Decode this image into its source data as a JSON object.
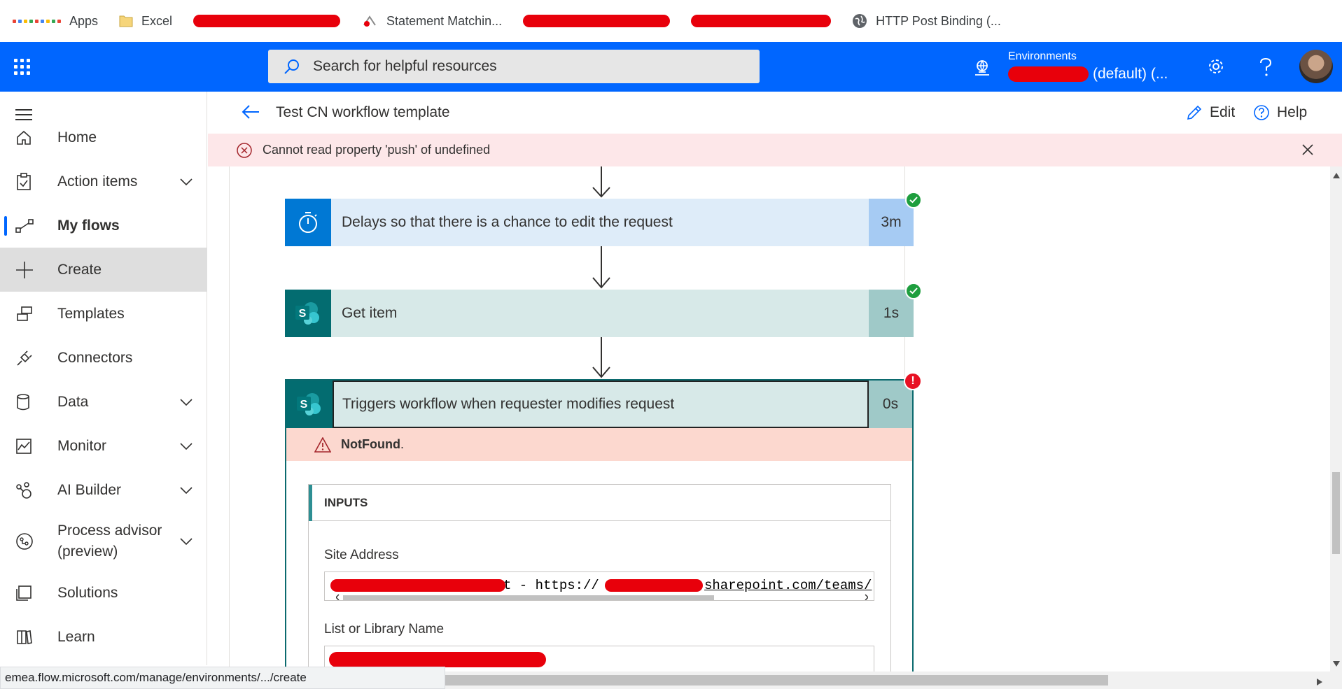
{
  "bookmarks": {
    "apps": "Apps",
    "excel": "Excel",
    "statement": "Statement Matchin...",
    "http": "HTTP Post Binding (..."
  },
  "header": {
    "search_placeholder": "Search for helpful resources",
    "env_label": "Environments",
    "env_name": "(default) (..."
  },
  "sidebar": {
    "items": [
      {
        "label": "Home"
      },
      {
        "label": "Action items"
      },
      {
        "label": "My flows"
      },
      {
        "label": "Create"
      },
      {
        "label": "Templates"
      },
      {
        "label": "Connectors"
      },
      {
        "label": "Data"
      },
      {
        "label": "Monitor"
      },
      {
        "label": "AI Builder"
      },
      {
        "label": "Process advisor",
        "label2": "(preview)"
      },
      {
        "label": "Solutions"
      },
      {
        "label": "Learn"
      }
    ]
  },
  "command_bar": {
    "flow_title": "Test CN workflow template",
    "edit": "Edit",
    "help": "Help"
  },
  "error_bar": {
    "message": "Cannot read property 'push' of undefined"
  },
  "flow": {
    "steps": [
      {
        "title": "Delays so that there is a chance to edit the request",
        "duration": "3m",
        "status": "succeeded",
        "color": "#0078d4"
      },
      {
        "title": "Get item",
        "duration": "1s",
        "status": "succeeded",
        "color": "#036c70"
      },
      {
        "title": "Triggers workflow when requester modifies request",
        "duration": "0s",
        "status": "failed",
        "color": "#036c70"
      }
    ],
    "error_text": "NotFound",
    "error_suffix": ".",
    "inputs_header": "INPUTS",
    "site_address_label": "Site Address",
    "site_address_visible": "t - https://",
    "site_address_suffix": "sharepoint.com/teams/",
    "list_name_label": "List or Library Name"
  },
  "status_url": "emea.flow.microsoft.com/manage/environments/.../create",
  "colors": {
    "brand_blue": "#0066ff",
    "error_red": "#e81123",
    "success_green": "#1e9e3e",
    "sharepoint_teal": "#036c70"
  }
}
